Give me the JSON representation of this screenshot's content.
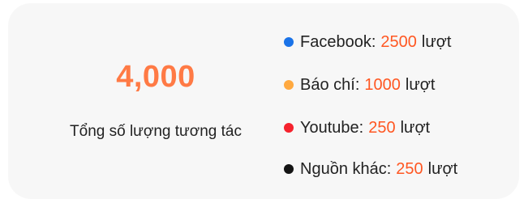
{
  "summary": {
    "total": "4,000",
    "label": "Tổng số lượng tương tác"
  },
  "legend": [
    {
      "label": "Facebook:",
      "value": "2500",
      "unit": "lượt",
      "color": "#1a73e8"
    },
    {
      "label": "Báo chí:",
      "value": "1000",
      "unit": "lượt",
      "color": "#ffa940"
    },
    {
      "label": "Youtube:",
      "value": "250",
      "unit": "lượt",
      "color": "#f5222d"
    },
    {
      "label": "Nguồn khác:",
      "value": "250",
      "unit": "lượt",
      "color": "#141414"
    }
  ],
  "colors": {
    "total": "#ff7a45",
    "value": "#ff5722",
    "card_background": "#f7f7f7"
  }
}
